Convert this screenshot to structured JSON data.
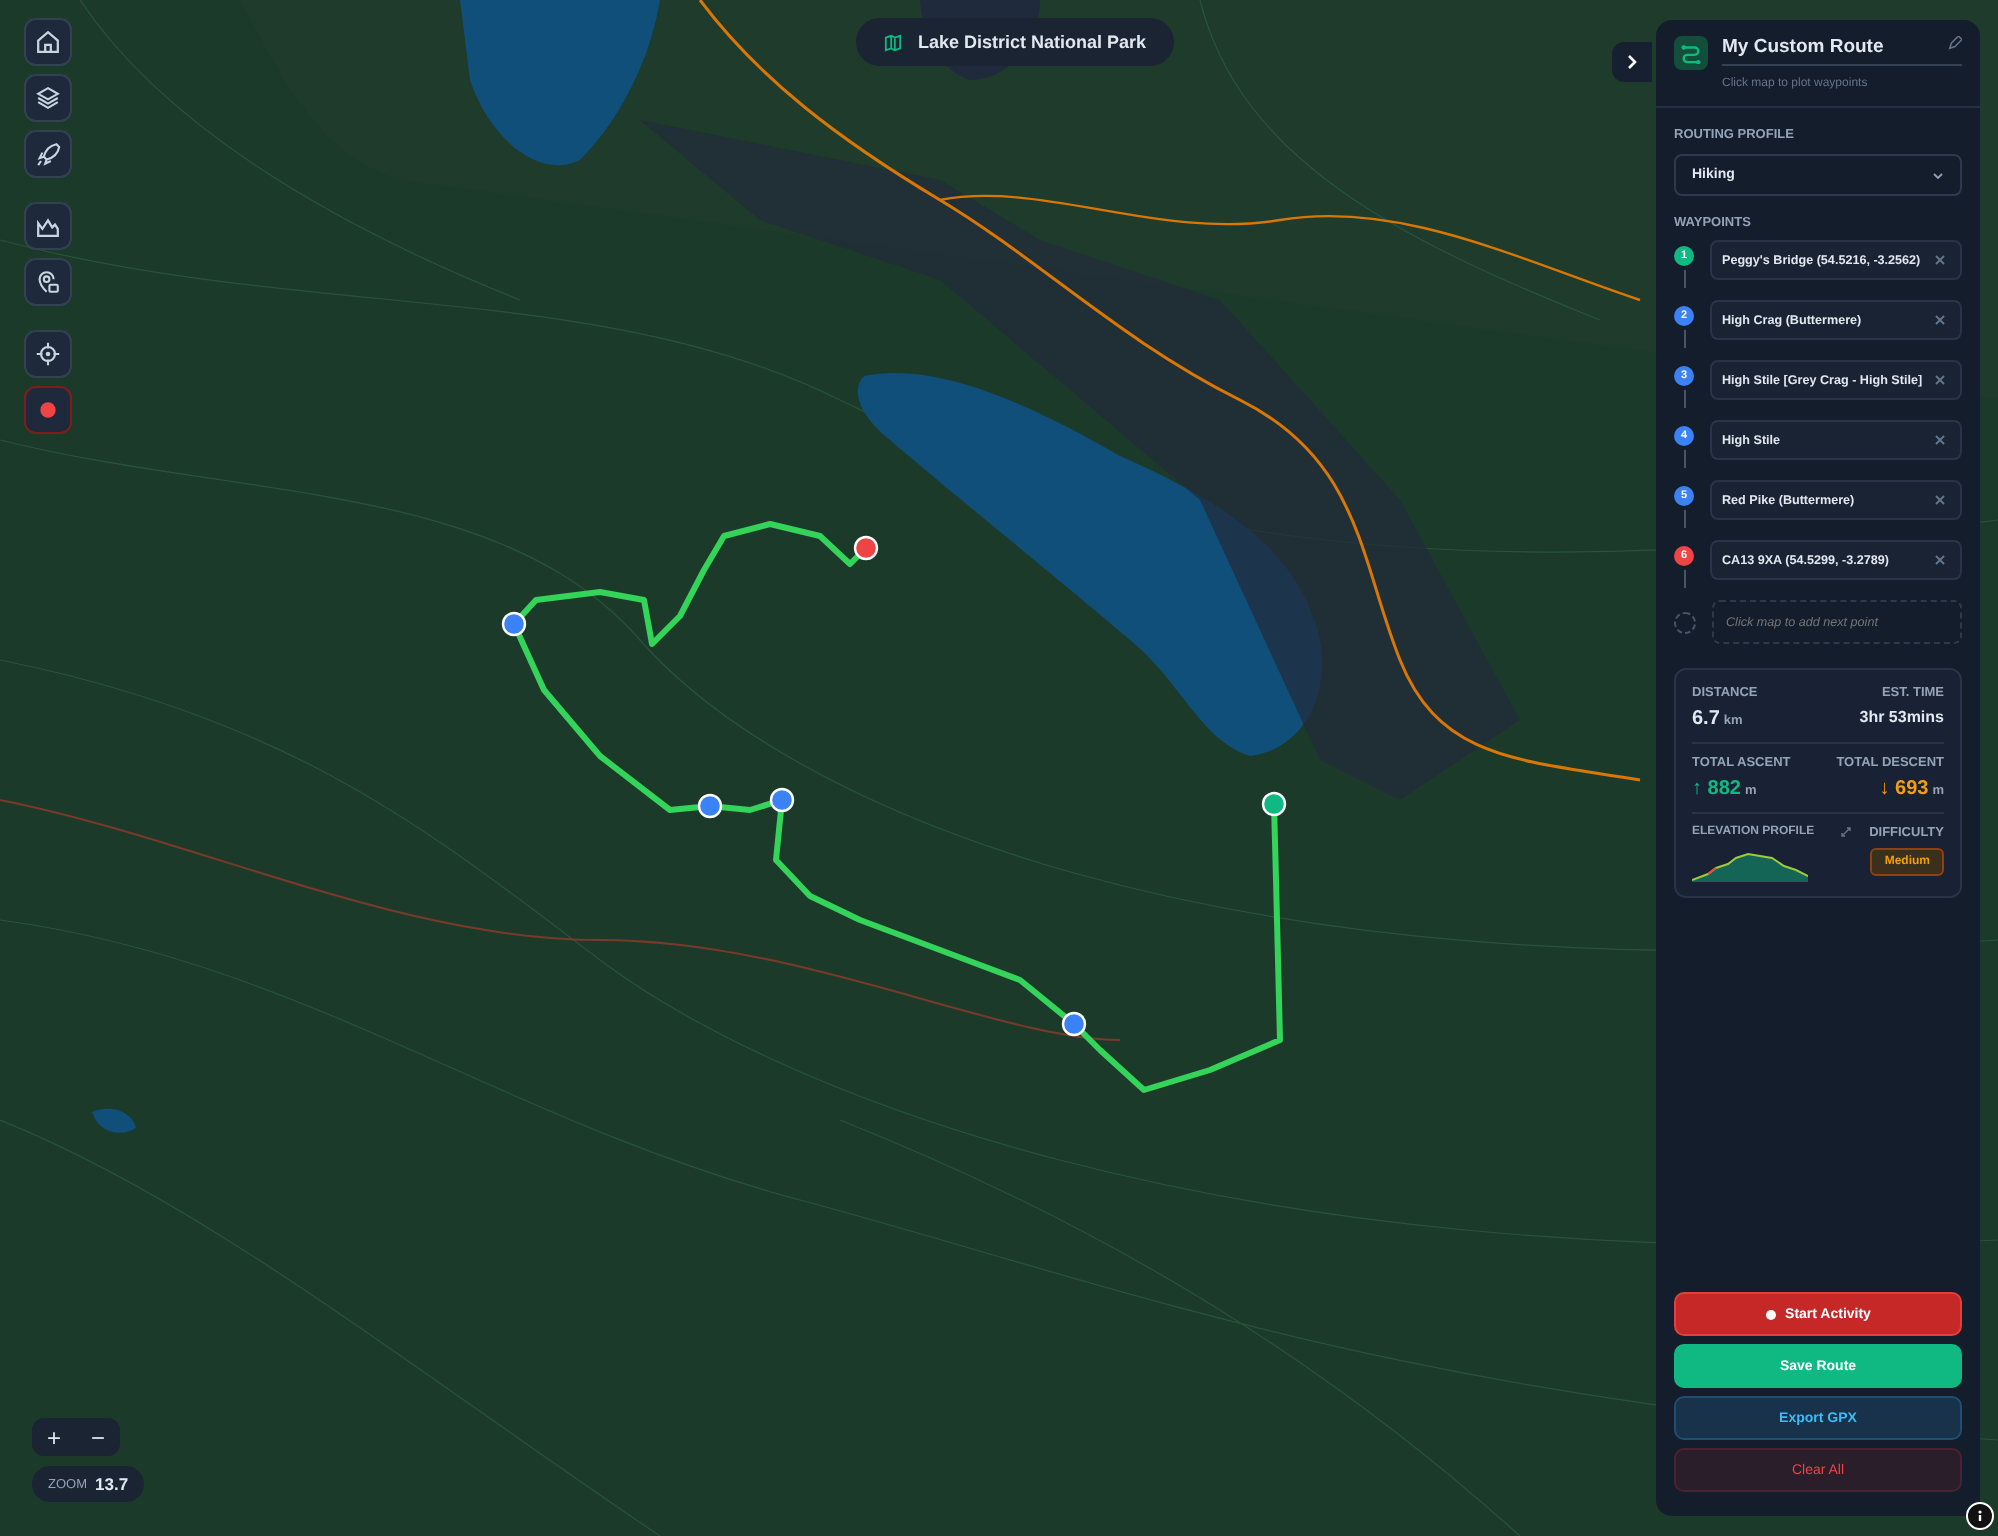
{
  "map_title": "Lake District National Park",
  "toolbar": [
    {
      "kind": "home"
    },
    {
      "kind": "layers"
    },
    {
      "kind": "rocket"
    },
    {
      "kind": "mountain"
    },
    {
      "kind": "pin"
    },
    {
      "kind": "locate"
    },
    {
      "kind": "record"
    }
  ],
  "zoom": {
    "plus": "+",
    "minus": "−",
    "label": "ZOOM",
    "value": "13.7"
  },
  "panel": {
    "route_name": "My Custom Route",
    "hint": "Click map to plot waypoints",
    "profile_label": "ROUTING PROFILE",
    "profile_value": "Hiking",
    "waypoints_label": "WAYPOINTS",
    "waypoints": [
      {
        "number": "1",
        "name": "Peggy's Bridge (54.5216, -3.2562)",
        "color": "#10b981"
      },
      {
        "number": "2",
        "name": "High Crag (Buttermere)",
        "color": "#3b82f6"
      },
      {
        "number": "3",
        "name": "High Stile [Grey Crag - High Stile]",
        "color": "#3b82f6"
      },
      {
        "number": "4",
        "name": "High Stile",
        "color": "#3b82f6"
      },
      {
        "number": "5",
        "name": "Red Pike (Buttermere)",
        "color": "#3b82f6"
      },
      {
        "number": "6",
        "name": "CA13 9XA (54.5299, -3.2789)",
        "color": "#ef4444"
      }
    ],
    "add_placeholder": "Click map to add next point",
    "stats": {
      "distance_label": "DISTANCE",
      "distance_value": "6.7",
      "distance_unit": "km",
      "time_label": "EST. TIME",
      "time_value": "3hr 53mins",
      "ascent_label": "TOTAL ASCENT",
      "ascent_arrow": "↑",
      "ascent_value": "882",
      "ascent_unit": "m",
      "descent_label": "TOTAL DESCENT",
      "descent_arrow": "↓",
      "descent_value": "693",
      "descent_unit": "m",
      "profile_label": "ELEVATION PROFILE",
      "difficulty_label": "DIFFICULTY",
      "difficulty_value": "Medium"
    },
    "buttons": [
      {
        "label": "Start Activity",
        "kind": "start"
      },
      {
        "label": "Save Route",
        "kind": "save"
      },
      {
        "label": "Export GPX",
        "kind": "export"
      },
      {
        "label": "Clear All",
        "kind": "clear"
      }
    ]
  }
}
